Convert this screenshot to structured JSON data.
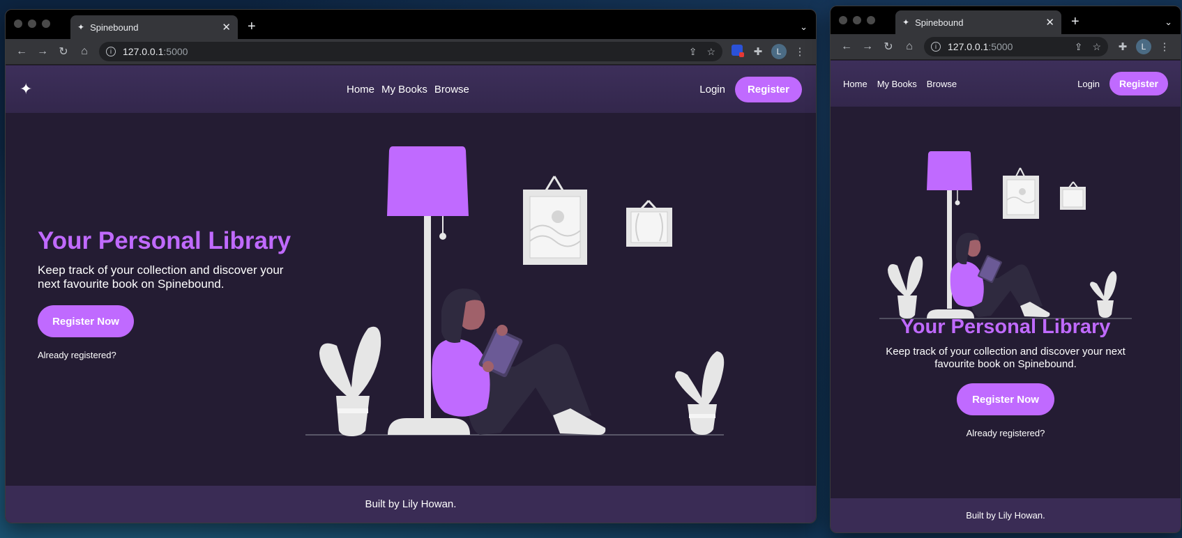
{
  "browser": {
    "tab_title": "Spinebound",
    "url_host": "127.0.0.1",
    "url_port": ":5000",
    "profile_initial": "L"
  },
  "site": {
    "nav": {
      "home": "Home",
      "my_books": "My Books",
      "browse": "Browse"
    },
    "login": "Login",
    "register": "Register",
    "hero": {
      "title": "Your Personal Library",
      "subtitle": "Keep track of your collection and discover your next favourite book on Spinebound.",
      "cta": "Register Now",
      "already": "Already registered?"
    },
    "footer": "Built by Lily Howan."
  },
  "colors": {
    "accent": "#c06aff",
    "page_bg": "#241c33",
    "header_bg": "#3d2f5a",
    "footer_bg": "#3a2c55"
  }
}
